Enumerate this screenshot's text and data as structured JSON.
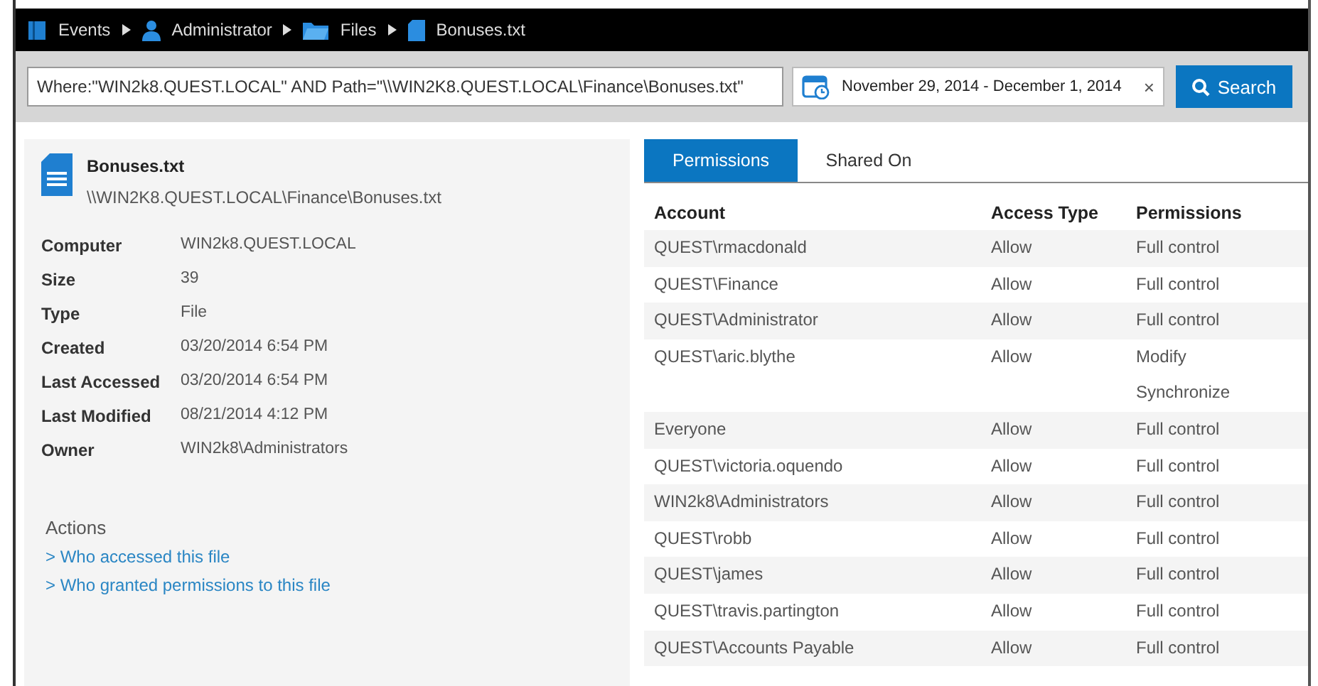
{
  "breadcrumb": [
    {
      "kind": "events",
      "label": "Events"
    },
    {
      "kind": "user",
      "label": "Administrator"
    },
    {
      "kind": "folder",
      "label": "Files"
    },
    {
      "kind": "file",
      "label": "Bonuses.txt"
    }
  ],
  "search": {
    "query": "Where:\"WIN2k8.QUEST.LOCAL\" AND Path=\"\\\\WIN2K8.QUEST.LOCAL\\Finance\\Bonuses.txt\"",
    "date_range": "November 29, 2014 - December 1, 2014",
    "clear": "×",
    "button": "Search"
  },
  "file": {
    "name": "Bonuses.txt",
    "path": "\\\\WIN2K8.QUEST.LOCAL\\Finance\\Bonuses.txt",
    "properties": [
      {
        "label": "Computer",
        "value": "WIN2k8.QUEST.LOCAL"
      },
      {
        "label": "Size",
        "value": "39"
      },
      {
        "label": "Type",
        "value": "File"
      },
      {
        "label": "Created",
        "value": "03/20/2014 6:54 PM"
      },
      {
        "label": "Last Accessed",
        "value": "03/20/2014 6:54 PM"
      },
      {
        "label": "Last Modified",
        "value": "08/21/2014 4:12 PM"
      },
      {
        "label": "Owner",
        "value": "WIN2k8\\Administrators"
      }
    ]
  },
  "actions": {
    "title": "Actions",
    "links": [
      "> Who accessed this file",
      "> Who granted permissions to this file"
    ]
  },
  "tabs": [
    {
      "label": "Permissions",
      "selected": true
    },
    {
      "label": "Shared On",
      "selected": false
    }
  ],
  "table": {
    "columns": [
      "Account",
      "Access Type",
      "Permissions"
    ],
    "rows": [
      {
        "account": "QUEST\\rmacdonald",
        "access": "Allow",
        "permissions": [
          "Full control"
        ]
      },
      {
        "account": "QUEST\\Finance",
        "access": "Allow",
        "permissions": [
          "Full control"
        ]
      },
      {
        "account": "QUEST\\Administrator",
        "access": "Allow",
        "permissions": [
          "Full control"
        ]
      },
      {
        "account": "QUEST\\aric.blythe",
        "access": "Allow",
        "permissions": [
          "Modify",
          "Synchronize"
        ]
      },
      {
        "account": "Everyone",
        "access": "Allow",
        "permissions": [
          "Full control"
        ]
      },
      {
        "account": "QUEST\\victoria.oquendo",
        "access": "Allow",
        "permissions": [
          "Full control"
        ]
      },
      {
        "account": "WIN2k8\\Administrators",
        "access": "Allow",
        "permissions": [
          "Full control"
        ]
      },
      {
        "account": "QUEST\\robb",
        "access": "Allow",
        "permissions": [
          "Full control"
        ]
      },
      {
        "account": "QUEST\\james",
        "access": "Allow",
        "permissions": [
          "Full control"
        ]
      },
      {
        "account": "QUEST\\travis.partington",
        "access": "Allow",
        "permissions": [
          "Full control"
        ]
      },
      {
        "account": "QUEST\\Accounts Payable",
        "access": "Allow",
        "permissions": [
          "Full control"
        ]
      }
    ]
  }
}
